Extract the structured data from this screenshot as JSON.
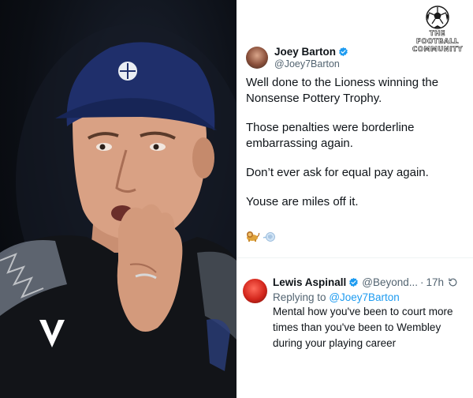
{
  "brand": {
    "name_line1": "The FOOTBALL",
    "name_line2": "COMMUNITY",
    "icon": "football-icon"
  },
  "tweet": {
    "author_name": "Joey Barton",
    "author_handle": "@Joey7Barton",
    "verified_icon": "verified-badge-icon",
    "paragraphs": [
      "Well done to the Lioness winning the Nonsense Pottery Trophy.",
      "Those penalties were borderline embarrassing again.",
      "Don’t ever ask for equal pay again.",
      "Youse are miles off it."
    ],
    "emoji_icons": [
      "lion-emoji-icon",
      "ball-emoji-icon"
    ]
  },
  "reply": {
    "author_name": "Lewis Aspinall",
    "author_handle": "@Beyond...",
    "separator": "·",
    "time": "17h",
    "replying_prefix": "Replying to",
    "replying_handle": "@Joey7Barton",
    "text": "Mental how you've been to court more times than you've been to Wembley during your playing career"
  },
  "colors": {
    "verified_blue": "#1d9bf0",
    "link_blue": "#1d9bf0",
    "muted_text": "#536471",
    "text": "#0f1419",
    "cap_navy": "#1f2f6b"
  }
}
